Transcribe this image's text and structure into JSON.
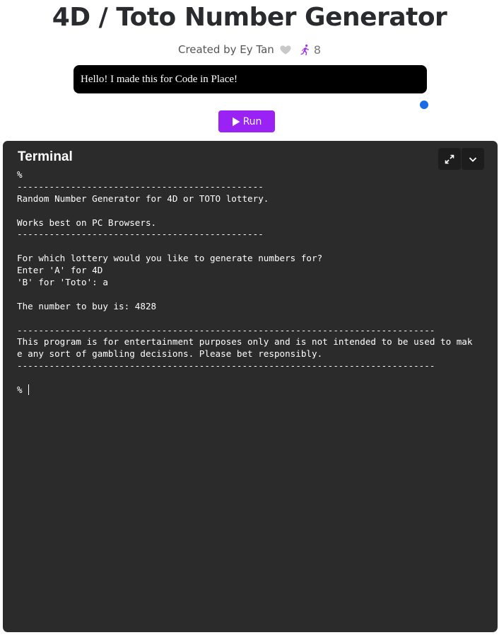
{
  "page": {
    "title": "4D / Toto Number Generator",
    "byline": "Created by Ey Tan",
    "run_count": "8",
    "message": "Hello! I made this for Code in Place!",
    "run_label": "Run",
    "icons": {
      "like": "heart-icon",
      "runs": "running-person-icon",
      "run": "play-icon"
    },
    "colors": {
      "run_button": "#9b22f5",
      "run_icon": "#a334e8",
      "status_dot": "#1a6be6",
      "terminal_bg": "#2b2b2b"
    }
  },
  "terminal": {
    "title": "Terminal",
    "icons": {
      "expand": "expand-icon",
      "collapse": "chevron-down-icon"
    },
    "lines": [
      "%",
      "----------------------------------------------",
      "Random Number Generator for 4D or TOTO lottery.",
      "",
      "Works best on PC Browsers.",
      "----------------------------------------------",
      "",
      "For which lottery would you like to generate numbers for?",
      "Enter 'A' for 4D",
      "'B' for 'Toto': a",
      "",
      "The number to buy is: 4828",
      "",
      "------------------------------------------------------------------------------",
      "This program is for entertainment purposes only and is not intended to be used to mak",
      "e any sort of gambling decisions. Please bet responsibly.",
      "------------------------------------------------------------------------------",
      "",
      "% "
    ]
  }
}
